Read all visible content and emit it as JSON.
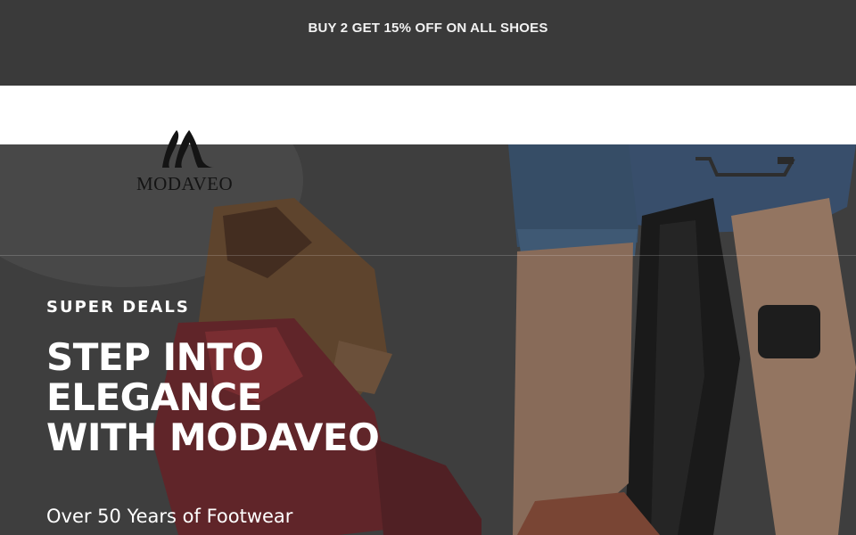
{
  "announcement": {
    "text": "BUY 2 GET 15% OFF ON ALL SHOES"
  },
  "brand": {
    "name": "MODAVEO"
  },
  "header": {
    "cart_icon": "cart-icon"
  },
  "hero": {
    "eyebrow": "SUPER DEALS",
    "headline_lines": [
      "STEP INTO",
      "ELEGANCE",
      "WITH MODAVEO"
    ],
    "subline": "Over 50 Years of Footwear"
  },
  "colors": {
    "announcement_bg": "#3a3a3a",
    "announcement_text": "#f2f2f2",
    "header_bg": "#ffffff",
    "hero_text": "#ffffff",
    "logo": "#141414"
  }
}
